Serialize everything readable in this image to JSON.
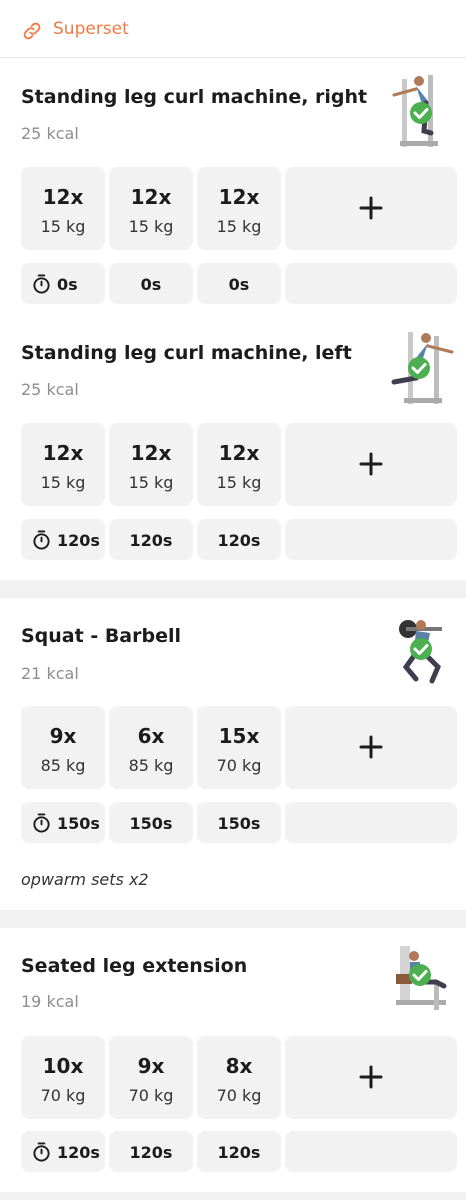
{
  "superset": {
    "label": "Superset",
    "icon": "link-icon",
    "color": "#f07a42"
  },
  "exercises": [
    {
      "title": "Standing leg curl machine, right",
      "kcal": "25 kcal",
      "image": "exercise-figure-completed",
      "sets": [
        {
          "reps": "12x",
          "weight": "15 kg"
        },
        {
          "reps": "12x",
          "weight": "15 kg"
        },
        {
          "reps": "12x",
          "weight": "15 kg"
        }
      ],
      "rest": [
        "0s",
        "0s",
        "0s"
      ],
      "note": ""
    },
    {
      "title": "Standing leg curl machine, left",
      "kcal": "25 kcal",
      "image": "exercise-figure-completed",
      "sets": [
        {
          "reps": "12x",
          "weight": "15 kg"
        },
        {
          "reps": "12x",
          "weight": "15 kg"
        },
        {
          "reps": "12x",
          "weight": "15 kg"
        }
      ],
      "rest": [
        "120s",
        "120s",
        "120s"
      ],
      "note": ""
    },
    {
      "title": "Squat - Barbell",
      "kcal": "21 kcal",
      "image": "exercise-figure-completed",
      "sets": [
        {
          "reps": "9x",
          "weight": "85 kg"
        },
        {
          "reps": "6x",
          "weight": "85 kg"
        },
        {
          "reps": "15x",
          "weight": "70 kg"
        }
      ],
      "rest": [
        "150s",
        "150s",
        "150s"
      ],
      "note": "opwarm sets x2"
    },
    {
      "title": "Seated leg extension",
      "kcal": "19 kcal",
      "image": "exercise-figure-completed",
      "sets": [
        {
          "reps": "10x",
          "weight": "70 kg"
        },
        {
          "reps": "9x",
          "weight": "70 kg"
        },
        {
          "reps": "8x",
          "weight": "70 kg"
        }
      ],
      "rest": [
        "120s",
        "120s",
        "120s"
      ],
      "note": ""
    }
  ],
  "colors": {
    "check": "#4caf50",
    "tile": "#f2f2f2",
    "accent": "#f07a42"
  }
}
